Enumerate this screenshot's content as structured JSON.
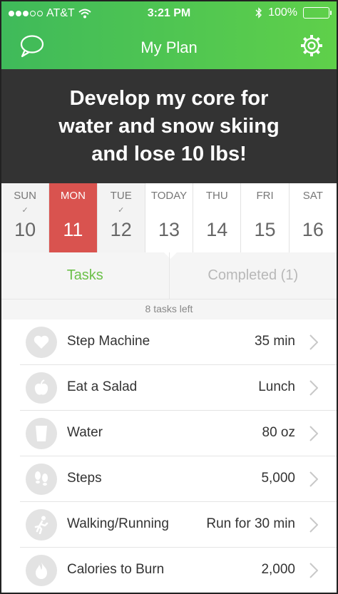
{
  "status_bar": {
    "carrier": "AT&T",
    "time": "3:21 PM",
    "battery": "100%",
    "signal_bars": 5,
    "signal_filled": 3
  },
  "nav": {
    "title": "My Plan",
    "left_icon": "chat-bubble-icon",
    "right_icon": "gear-icon"
  },
  "goal": {
    "text": "Develop my core for water and snow skiing and lose 10 lbs!"
  },
  "week": {
    "days": [
      {
        "name": "SUN",
        "number": "10",
        "completed": true,
        "state": "past"
      },
      {
        "name": "MON",
        "number": "11",
        "completed": false,
        "state": "selected"
      },
      {
        "name": "TUE",
        "number": "12",
        "completed": true,
        "state": "past"
      },
      {
        "name": "TODAY",
        "number": "13",
        "completed": false,
        "state": "today"
      },
      {
        "name": "THU",
        "number": "14",
        "completed": false,
        "state": "future"
      },
      {
        "name": "FRI",
        "number": "15",
        "completed": false,
        "state": "future"
      },
      {
        "name": "SAT",
        "number": "16",
        "completed": false,
        "state": "future"
      }
    ],
    "selected_color": "#d9534f"
  },
  "tabs": {
    "tasks_label": "Tasks",
    "completed_label": "Completed (1)",
    "active_color": "#6cc04a"
  },
  "tasks_left": "8 tasks left",
  "tasks": [
    {
      "name": "Step Machine",
      "value": "35 min",
      "icon": "heart-icon"
    },
    {
      "name": "Eat a Salad",
      "value": "Lunch",
      "icon": "apple-icon"
    },
    {
      "name": "Water",
      "value": "80 oz",
      "icon": "glass-icon"
    },
    {
      "name": "Steps",
      "value": "5,000",
      "icon": "footprints-icon"
    },
    {
      "name": "Walking/Running",
      "value": "Run for 30 min",
      "icon": "runner-icon"
    },
    {
      "name": "Calories to Burn",
      "value": "2,000",
      "icon": "flame-icon"
    }
  ],
  "colors": {
    "header_green": "#4cc552",
    "banner": "#333333"
  }
}
